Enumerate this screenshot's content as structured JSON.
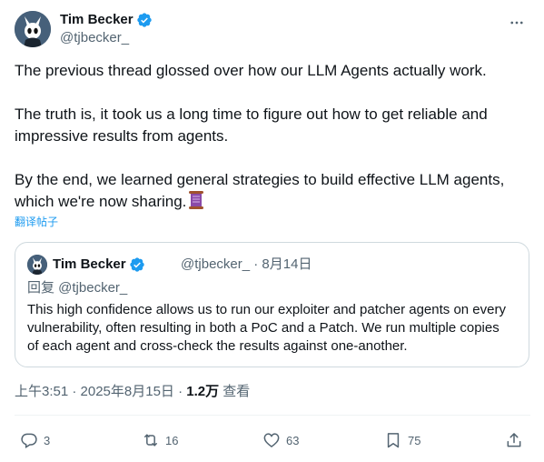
{
  "author": {
    "name": "Tim Becker",
    "handle": "@tjbecker_",
    "verified": true
  },
  "tweet": {
    "paragraph1": "The previous thread glossed over how our LLM Agents actually work.",
    "paragraph2": "The truth is, it took us a long time to figure out how to get reliable and impressive results from agents.",
    "paragraph3": "By the end, we learned general strategies to build effective LLM agents, which we're now sharing.",
    "emoji": "scroll-emoji",
    "translate_label": "翻译帖子"
  },
  "quoted": {
    "name": "Tim Becker",
    "handle": "@tjbecker_",
    "date": "· 8月14日",
    "reply_to": "回复 @tjbecker_",
    "text": "This high confidence allows us to run our exploiter and patcher agents on every vulnerability, often resulting in both a PoC and a Patch. We run multiple copies of each agent and cross-check the results against one-another."
  },
  "meta": {
    "time": "上午3:51 · 2025年8月15日 · ",
    "views_count": "1.2万",
    "views_label": " 查看"
  },
  "actions": {
    "replies": "3",
    "retweets": "16",
    "likes": "63",
    "bookmarks": "75"
  },
  "colors": {
    "accent": "#1d9bf0",
    "secondary_text": "#536471",
    "border": "#cfd9de"
  }
}
